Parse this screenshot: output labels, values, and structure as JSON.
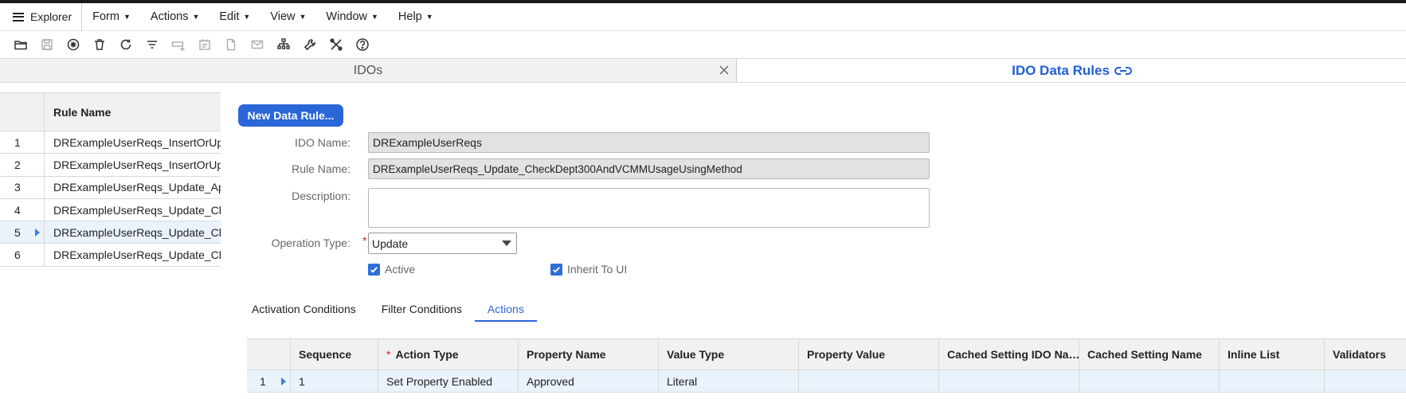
{
  "menubar": {
    "explorer_label": "Explorer",
    "menus": [
      {
        "label": "Form"
      },
      {
        "label": "Actions"
      },
      {
        "label": "Edit"
      },
      {
        "label": "View"
      },
      {
        "label": "Window"
      },
      {
        "label": "Help"
      }
    ],
    "caret": "▼"
  },
  "toolbar": {
    "icons": [
      "open-folder-icon",
      "save-icon",
      "new-icon",
      "delete-icon",
      "refresh-icon",
      "filter-icon",
      "add-row-icon",
      "calendar-icon",
      "document-icon",
      "mail-icon",
      "hierarchy-icon",
      "wrench-icon",
      "tools-icon",
      "help-icon"
    ]
  },
  "tabs": {
    "idos_label": "IDOs",
    "rules_label": "IDO Data Rules",
    "accent_color": "#1f5fd6"
  },
  "left_grid": {
    "header": "Rule Name",
    "rows": [
      {
        "num": "1",
        "name": "DRExampleUserReqs_InsertOrUpdate"
      },
      {
        "num": "2",
        "name": "DRExampleUserReqs_InsertOrUpdate"
      },
      {
        "num": "3",
        "name": "DRExampleUserReqs_Update_Approved"
      },
      {
        "num": "4",
        "name": "DRExampleUserReqs_Update_Check"
      },
      {
        "num": "5",
        "name": "DRExampleUserReqs_Update_Check"
      },
      {
        "num": "6",
        "name": "DRExampleUserReqs_Update_Check"
      }
    ],
    "selected_row": 5
  },
  "form": {
    "new_rule_button": "New Data Rule...",
    "ido_name_label": "IDO Name:",
    "ido_name_value": "DRExampleUserReqs",
    "rule_name_label": "Rule Name:",
    "rule_name_value": "DRExampleUserReqs_Update_CheckDept300AndVCMMUsageUsingMethod",
    "description_label": "Description:",
    "description_value": "",
    "operation_type_label": "Operation Type:",
    "required_mark": "*",
    "operation_type_value": "Update",
    "active_label": "Active",
    "inherit_label": "Inherit To UI"
  },
  "subtabs": [
    {
      "label": "Activation Conditions"
    },
    {
      "label": "Filter Conditions"
    },
    {
      "label": "Actions"
    }
  ],
  "actions_grid": {
    "headers": [
      "Sequence",
      "Action Type",
      "Property Name",
      "Value Type",
      "Property Value",
      "Cached Setting IDO Na…",
      "Cached Setting Name",
      "Inline List",
      "Validators"
    ],
    "required_mark": "*",
    "rows": [
      {
        "num": "1",
        "sequence": "1",
        "action_type": "Set Property Enabled",
        "property_name": "Approved",
        "value_type": "Literal",
        "property_value": "",
        "cached_ido": "",
        "cached_name": "",
        "inline_list": "",
        "validators": ""
      }
    ]
  }
}
